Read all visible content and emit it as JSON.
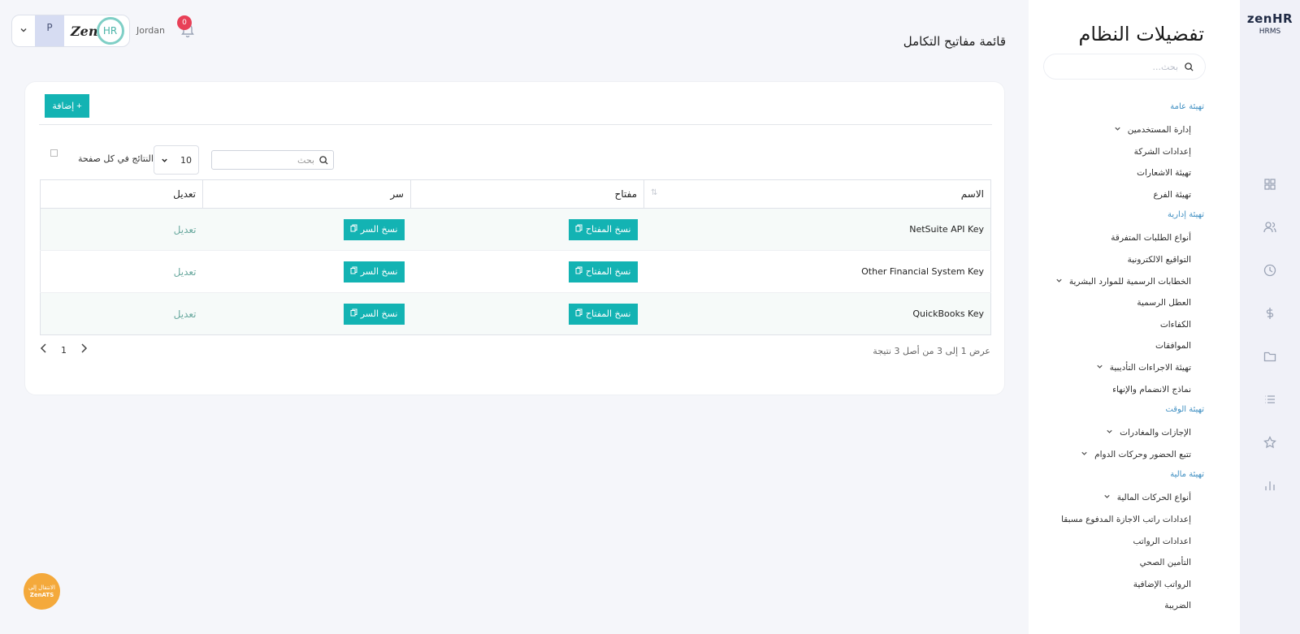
{
  "brand": {
    "name": "zenHR",
    "sub": "HRMS"
  },
  "header": {
    "country": "Jordan",
    "notifications": "0",
    "avatar_initial": "P",
    "logo_text": "Zen",
    "logo_circle": "HR",
    "page_title": "قائمة مفاتيح التكامل"
  },
  "settings": {
    "title": "تفضيلات النظام",
    "search_placeholder": "بحث...",
    "menu": [
      {
        "type": "section",
        "label": "تهيئة عامة"
      },
      {
        "type": "item",
        "label": "إدارة المستخدمين",
        "expandable": true
      },
      {
        "type": "item",
        "label": "إعدادات الشركة"
      },
      {
        "type": "item",
        "label": "تهيئة الاشعارات"
      },
      {
        "type": "item",
        "label": "تهيئة الفرع"
      },
      {
        "type": "section",
        "label": "تهيئة إدارية"
      },
      {
        "type": "item",
        "label": "أنواع الطلبات المتفرقة"
      },
      {
        "type": "item",
        "label": "التواقيع الالكترونية"
      },
      {
        "type": "item",
        "label": "الخطابات الرسمية للموارد البشرية",
        "expandable": true
      },
      {
        "type": "item",
        "label": "العطل الرسمية"
      },
      {
        "type": "item",
        "label": "الكفاءات"
      },
      {
        "type": "item",
        "label": "الموافقات"
      },
      {
        "type": "item",
        "label": "تهيئة الاجراءات التأديبية",
        "expandable": true
      },
      {
        "type": "item",
        "label": "نماذج الانضمام والإنهاء"
      },
      {
        "type": "section",
        "label": "تهيئة الوقت"
      },
      {
        "type": "item",
        "label": "الإجازات والمغادرات",
        "expandable": true
      },
      {
        "type": "item",
        "label": "تتبع الحضور وحركات الدوام",
        "expandable": true
      },
      {
        "type": "section",
        "label": "تهيئة مالية"
      },
      {
        "type": "item",
        "label": "أنواع الحركات المالية",
        "expandable": true
      },
      {
        "type": "item",
        "label": "إعدادات راتب الاجازة المدفوع مسبقا"
      },
      {
        "type": "item",
        "label": "اعدادات الرواتب"
      },
      {
        "type": "item",
        "label": "التأمين الصحي"
      },
      {
        "type": "item",
        "label": "الرواتب الإضافية"
      },
      {
        "type": "item",
        "label": "الضريبة"
      }
    ]
  },
  "toolbar": {
    "add_label": "+ إضافة",
    "per_page_value": "10",
    "per_page_label": "النتائج في كل صفحة",
    "search_placeholder": "بحث"
  },
  "table": {
    "columns": {
      "name": "الاسم",
      "key": "مفتاح",
      "secret": "سر",
      "edit": "تعديل"
    },
    "copy_key_label": "نسخ المفتاح",
    "copy_secret_label": "نسخ السر",
    "edit_label": "تعديل",
    "rows": [
      {
        "name": "NetSuite API Key"
      },
      {
        "name": "Other Financial System Key"
      },
      {
        "name": "QuickBooks Key"
      }
    ]
  },
  "pagination": {
    "current_page": "1",
    "summary": "عرض 1 إلى 3 من أصل 3 نتيجة"
  },
  "fab": {
    "line1": "الانتقال إلى",
    "line2": "ZenATS"
  },
  "colors": {
    "accent": "#13b3b3",
    "badge": "#e84057",
    "fab": "#f4a93b",
    "section": "#3f8fc2"
  }
}
